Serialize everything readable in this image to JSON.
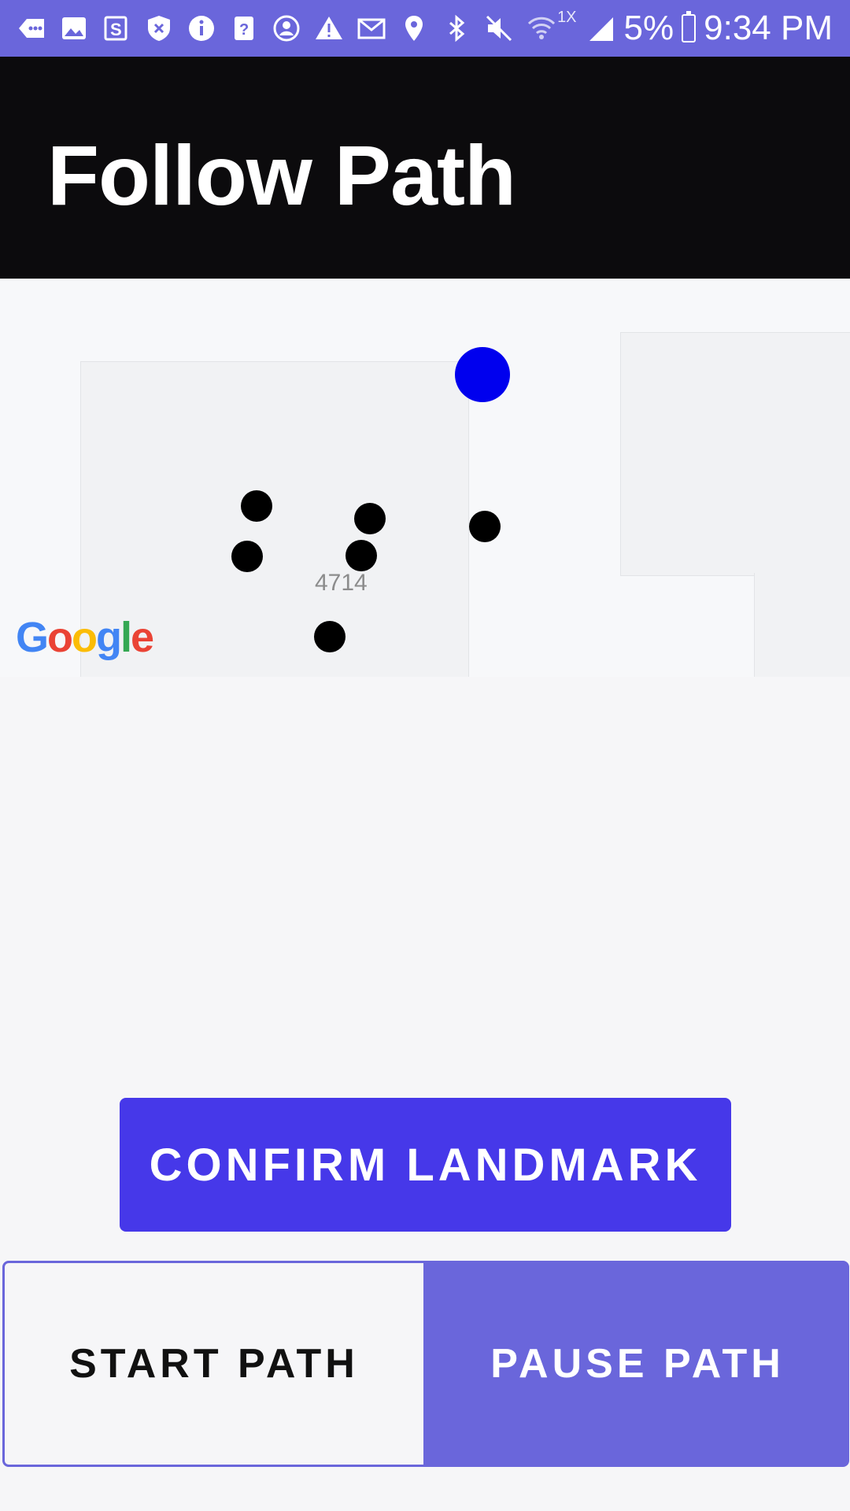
{
  "status_bar": {
    "icons": [
      "messages-icon",
      "gallery-icon",
      "s-app-icon",
      "shield-icon",
      "info-icon",
      "help-icon",
      "account-icon",
      "warning-icon",
      "mail-icon",
      "location-icon",
      "bluetooth-icon",
      "mute-icon",
      "wifi-icon"
    ],
    "network_label": "1X",
    "battery": "5%",
    "time": "9:34 PM"
  },
  "app_bar": {
    "title": "Follow Path"
  },
  "map": {
    "building_label": "4714",
    "attribution": "Google"
  },
  "buttons": {
    "confirm": "CONFIRM LANDMARK",
    "start": "START PATH",
    "pause": "PAUSE PATH"
  },
  "colors": {
    "status_bar": "#6a66db",
    "app_bar": "#0c0b0d",
    "primary_button": "#4638e9",
    "toggle_active": "#6a66db",
    "current_location": "#0000ee"
  }
}
